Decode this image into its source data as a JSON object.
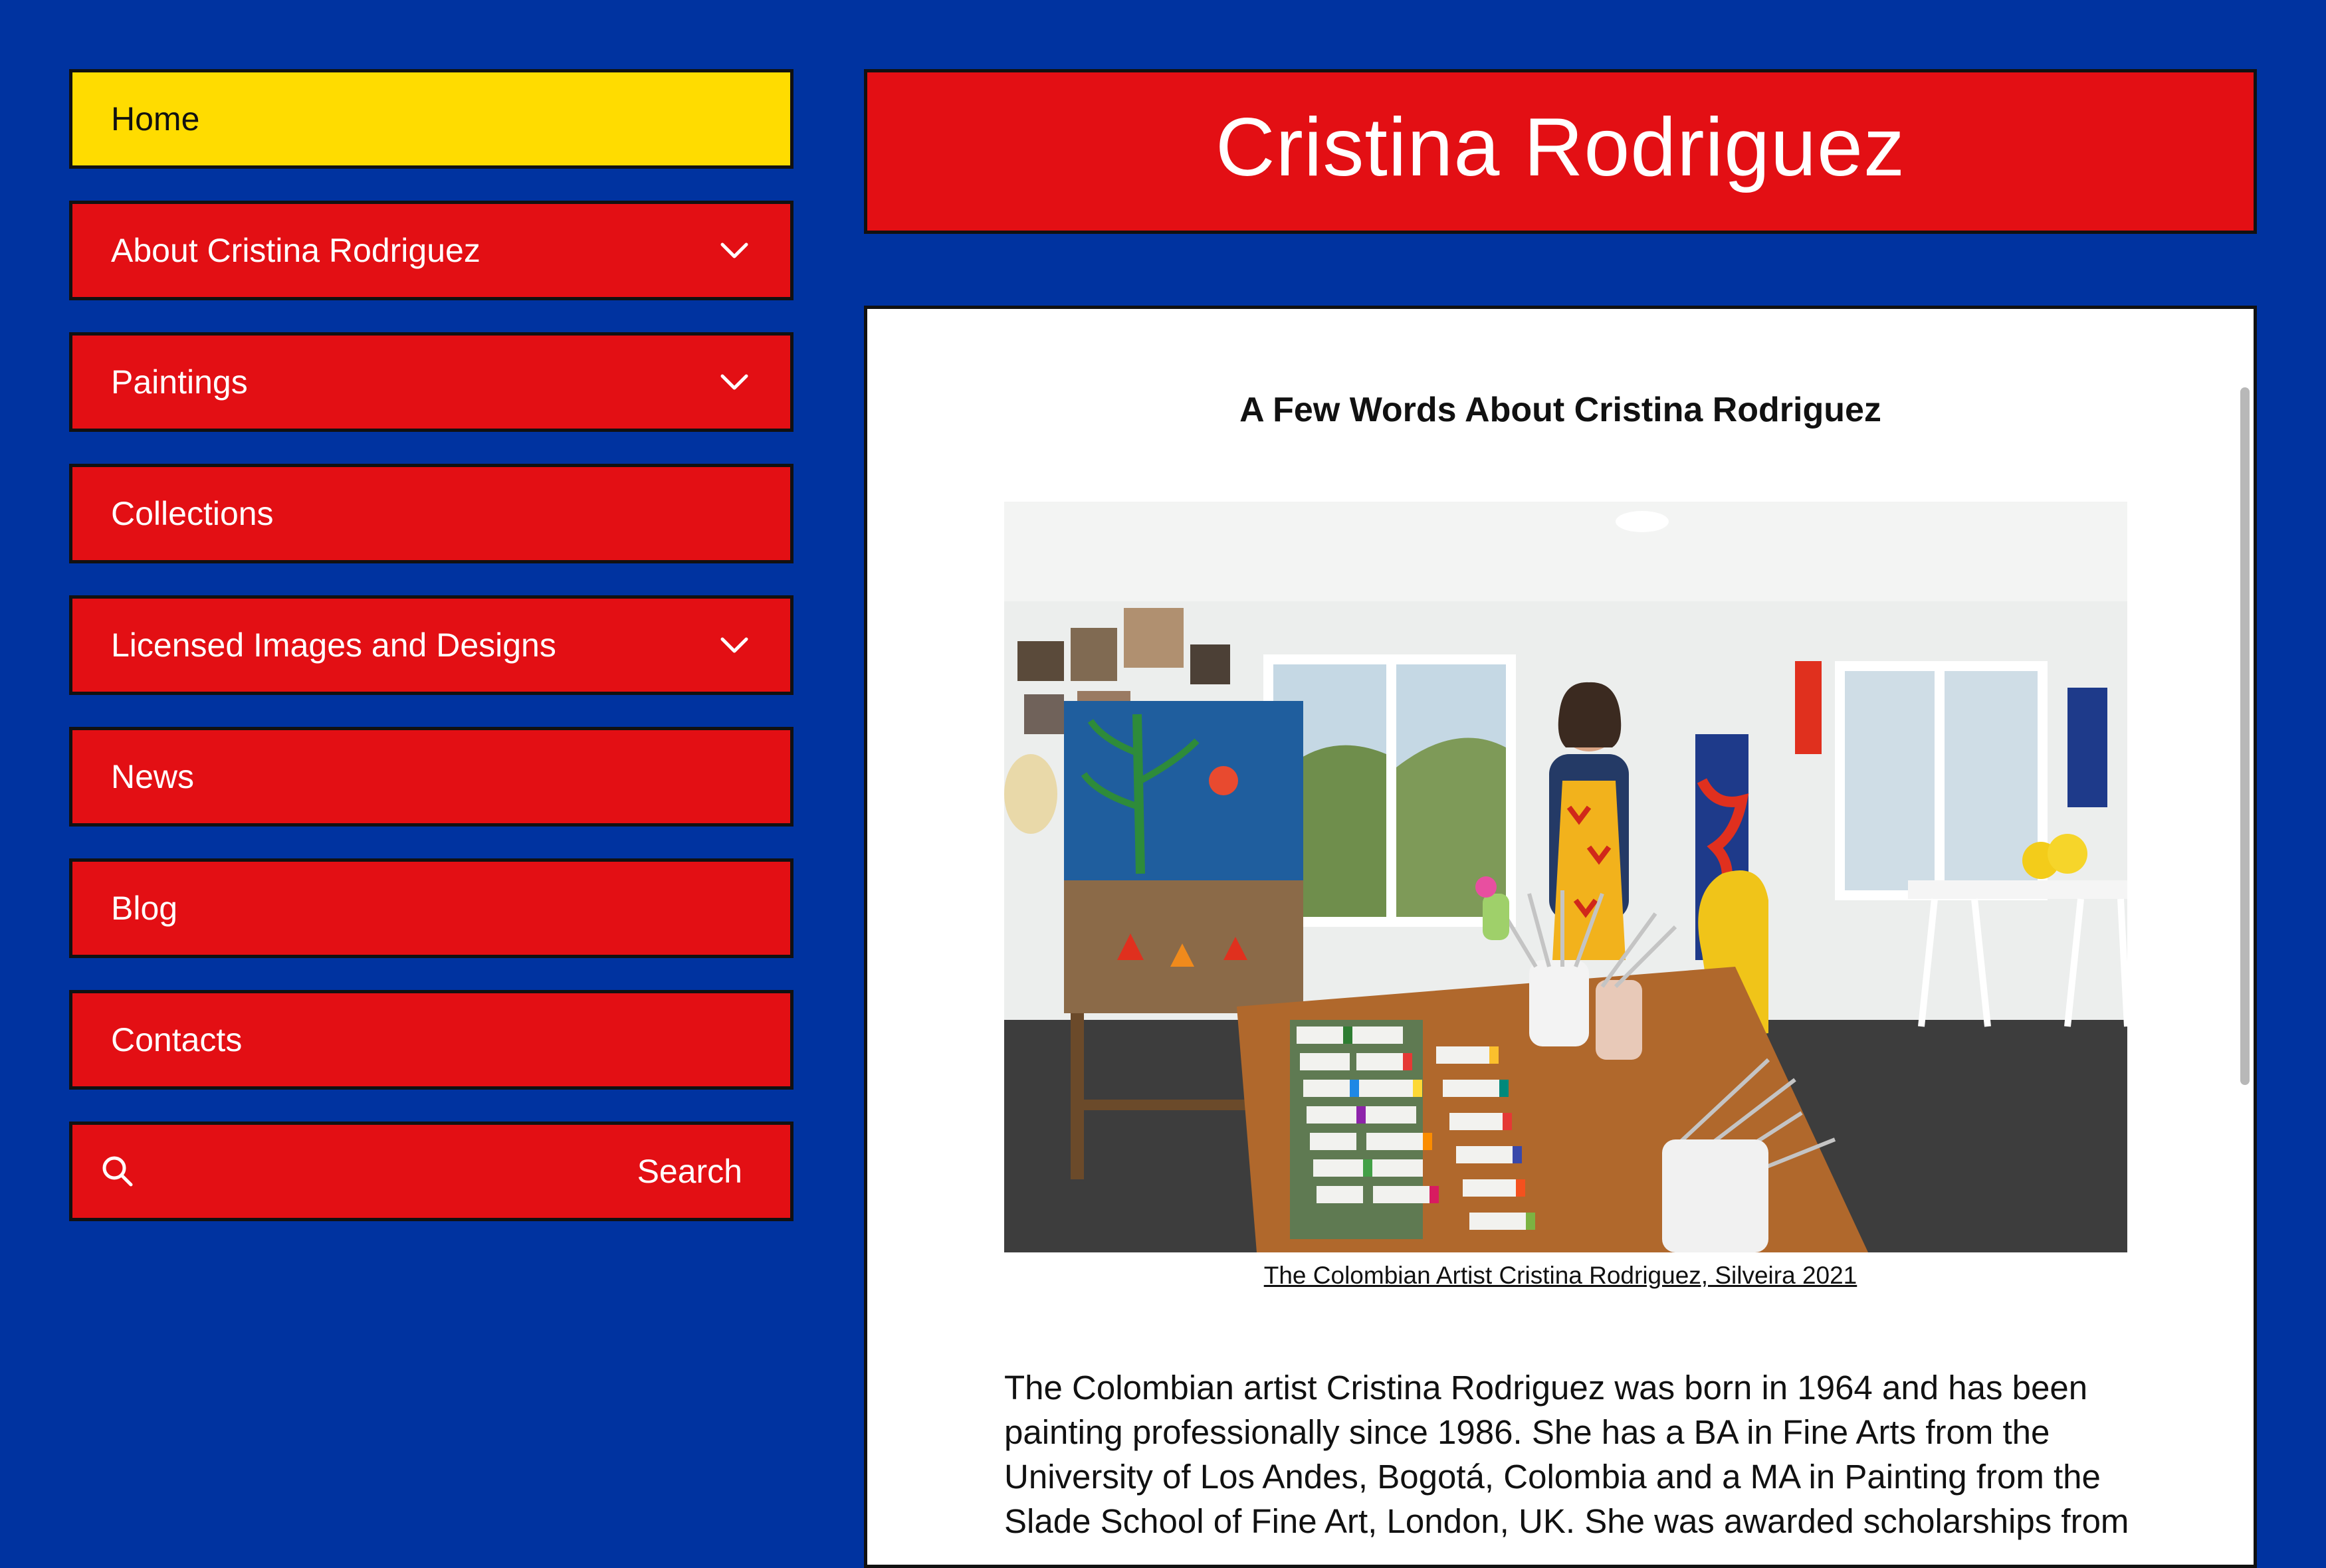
{
  "site_title": "Cristina Rodriguez",
  "nav": {
    "items": [
      {
        "label": "Home",
        "has_submenu": false,
        "active": true
      },
      {
        "label": "About Cristina Rodriguez",
        "has_submenu": true,
        "active": false
      },
      {
        "label": "Paintings",
        "has_submenu": true,
        "active": false
      },
      {
        "label": "Collections",
        "has_submenu": false,
        "active": false
      },
      {
        "label": "Licensed Images and Designs",
        "has_submenu": true,
        "active": false
      },
      {
        "label": "News",
        "has_submenu": false,
        "active": false
      },
      {
        "label": "Blog",
        "has_submenu": false,
        "active": false
      },
      {
        "label": "Contacts",
        "has_submenu": false,
        "active": false
      }
    ],
    "search": {
      "placeholder": "Search",
      "icon": "search-icon"
    }
  },
  "content": {
    "heading": "A Few Words About Cristina Rodriguez",
    "photo_caption": "The Colombian Artist Cristina Rodriguez, Silveira 2021",
    "body": "The Colombian artist Cristina Rodriguez was born in 1964 and has been painting professionally since 1986. She has a BA in Fine Arts from the University of Los Andes, Bogotá, Colombia and a MA in Painting from the Slade School of Fine Art, London, UK. She was awarded scholarships from"
  },
  "colors": {
    "background": "#0033A0",
    "nav_red": "#E30F14",
    "active_yellow": "#FFDC00",
    "border": "#111111",
    "panel": "#FFFFFF"
  }
}
